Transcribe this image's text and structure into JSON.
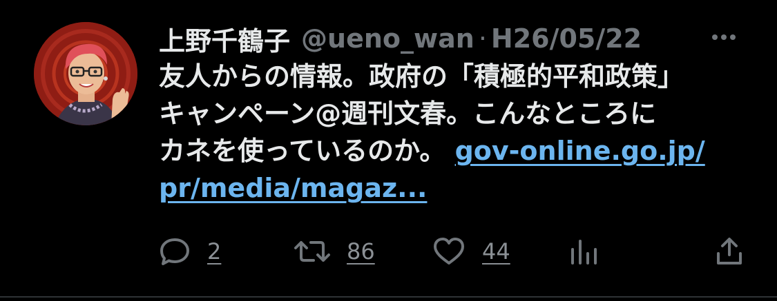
{
  "tweet": {
    "display_name": "上野千鶴子",
    "handle": "@ueno_wan",
    "separator": "·",
    "date": "H26/05/22",
    "text_lines": [
      "友人からの情報。政府の「積極的平和政策」",
      "キャンペーン@週刊文春。こんなところに",
      "カネを使っているのか。 "
    ],
    "link_part1": "gov-online.go.jp/",
    "link_part2": "pr/media/magaz..."
  },
  "actions": {
    "reply_count": "2",
    "retweet_count": "86",
    "like_count": "44"
  },
  "colors": {
    "background": "#000000",
    "text": "#e7e9ea",
    "secondary": "#71767b",
    "link": "#6cb5ef",
    "avatar_bg": "#8f1d14"
  },
  "icons": [
    "more-icon",
    "reply-icon",
    "retweet-icon",
    "like-icon",
    "views-icon",
    "share-icon"
  ]
}
